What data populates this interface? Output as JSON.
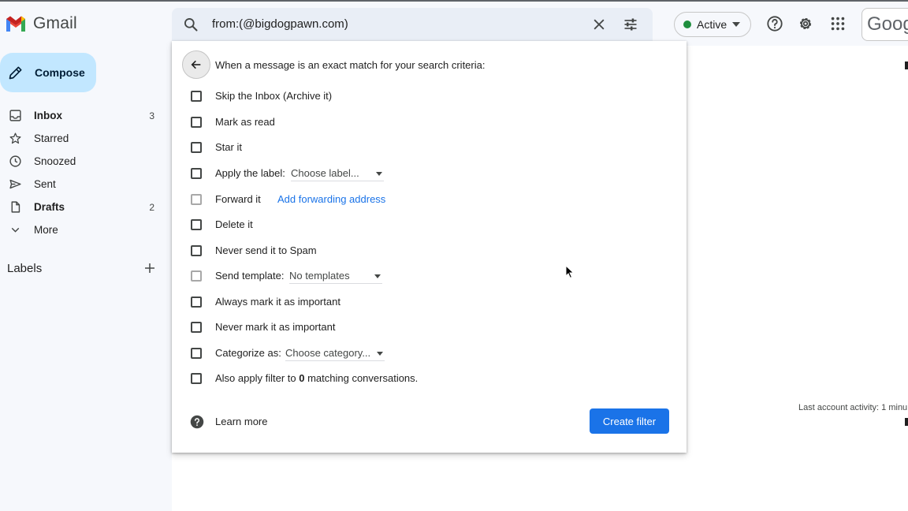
{
  "app": {
    "name": "Gmail"
  },
  "colors": {
    "accent": "#1a73e8",
    "compose_bg": "#c2e7ff",
    "status_active": "#1e8e3e"
  },
  "search": {
    "query": "from:(@bigdogpawn.com)"
  },
  "header": {
    "status": "Active",
    "account_text": "Goog"
  },
  "sidebar": {
    "compose_label": "Compose",
    "items": [
      {
        "label": "Inbox",
        "count": "3",
        "icon": "inbox-icon"
      },
      {
        "label": "Starred",
        "count": "",
        "icon": "star-icon"
      },
      {
        "label": "Snoozed",
        "count": "",
        "icon": "clock-icon"
      },
      {
        "label": "Sent",
        "count": "",
        "icon": "send-icon"
      },
      {
        "label": "Drafts",
        "count": "2",
        "icon": "draft-icon"
      },
      {
        "label": "More",
        "count": "",
        "icon": "chevron-down-icon"
      }
    ],
    "labels_heading": "Labels"
  },
  "filter": {
    "heading": "When a message is an exact match for your search criteria:",
    "options": {
      "skip_inbox": "Skip the Inbox (Archive it)",
      "mark_read": "Mark as read",
      "star": "Star it",
      "apply_label": "Apply the label:",
      "forward": "Forward it",
      "delete": "Delete it",
      "never_spam": "Never send it to Spam",
      "send_template": "Send template:",
      "always_important": "Always mark it as important",
      "never_important": "Never mark it as important",
      "categorize": "Categorize as:",
      "also_apply_prefix": "Also apply filter to",
      "also_apply_count": "0",
      "also_apply_suffix": "matching conversations."
    },
    "dropdowns": {
      "label": "Choose label...",
      "template": "No templates",
      "category": "Choose category..."
    },
    "forward_link": "Add forwarding address",
    "learn_more": "Learn more",
    "create_button": "Create filter"
  },
  "main": {
    "activity_text": "Last account activity: 1 minu"
  }
}
